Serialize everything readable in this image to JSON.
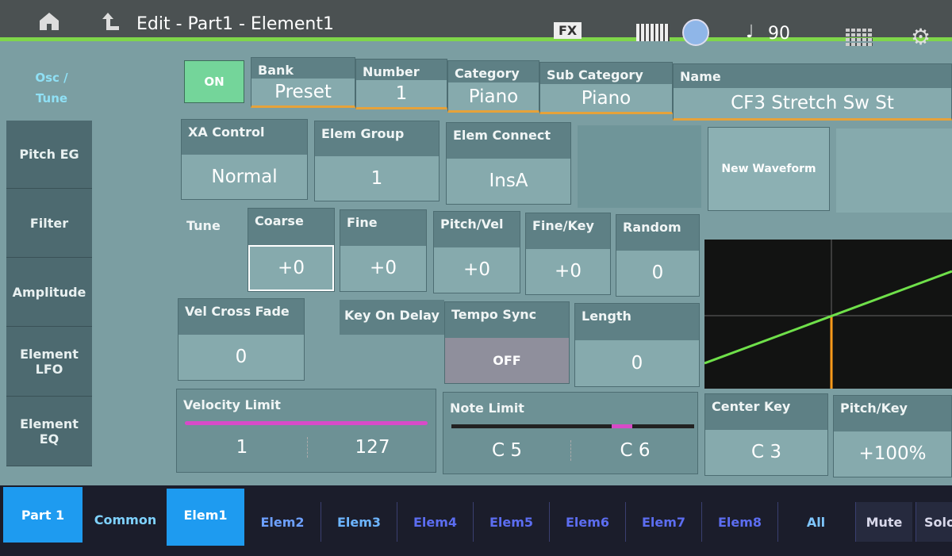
{
  "header": {
    "title": "Edit - Part1 - Element1",
    "fx_label": "FX",
    "tempo": "90",
    "colors": {
      "accent_line": "#7fd64a",
      "tab_active": "#1e9bf0"
    }
  },
  "sidebar": {
    "items": [
      {
        "label": "Osc / Tune"
      },
      {
        "label": "Pitch EG"
      },
      {
        "label": "Filter"
      },
      {
        "label": "Amplitude"
      },
      {
        "label": "Element LFO"
      },
      {
        "label": "Element EQ"
      }
    ]
  },
  "row1": {
    "on": "ON",
    "bank": {
      "label": "Bank",
      "value": "Preset"
    },
    "number": {
      "label": "Number",
      "value": "1"
    },
    "category": {
      "label": "Category",
      "value": "Piano"
    },
    "sub_category": {
      "label": "Sub Category",
      "value": "Piano"
    },
    "name": {
      "label": "Name",
      "value": "CF3 Stretch Sw St"
    }
  },
  "row2": {
    "xa": {
      "label": "XA Control",
      "value": "Normal"
    },
    "group": {
      "label": "Elem Group",
      "value": "1"
    },
    "connect": {
      "label": "Elem Connect",
      "value": "InsA"
    },
    "new_waveform": "New Waveform"
  },
  "tune": {
    "label": "Tune",
    "coarse": {
      "label": "Coarse",
      "value": "+0"
    },
    "fine": {
      "label": "Fine",
      "value": "+0"
    },
    "pitch_vel": {
      "label": "Pitch/Vel",
      "value": "+0"
    },
    "fine_key": {
      "label": "Fine/Key",
      "value": "+0"
    },
    "random": {
      "label": "Random",
      "value": "0"
    }
  },
  "row4": {
    "vel_cross": {
      "label": "Vel Cross Fade",
      "value": "0"
    },
    "key_on_delay": "Key On Delay",
    "tempo_sync": {
      "label": "Tempo Sync",
      "value": "OFF"
    },
    "length": {
      "label": "Length",
      "value": "0"
    }
  },
  "limits": {
    "velocity": {
      "label": "Velocity Limit",
      "low": "1",
      "high": "127"
    },
    "note": {
      "label": "Note Limit",
      "low": "C 5",
      "high": "C 6"
    },
    "center_key": {
      "label": "Center Key",
      "value": "C 3"
    },
    "pitch_key": {
      "label": "Pitch/Key",
      "value": "+100%"
    }
  },
  "bottom": {
    "part": "Part 1",
    "tabs": [
      "Common",
      "Elem1",
      "Elem2",
      "Elem3",
      "Elem4",
      "Elem5",
      "Elem6",
      "Elem7",
      "Elem8",
      "All"
    ],
    "mute": "Mute",
    "solo": "Solo"
  }
}
